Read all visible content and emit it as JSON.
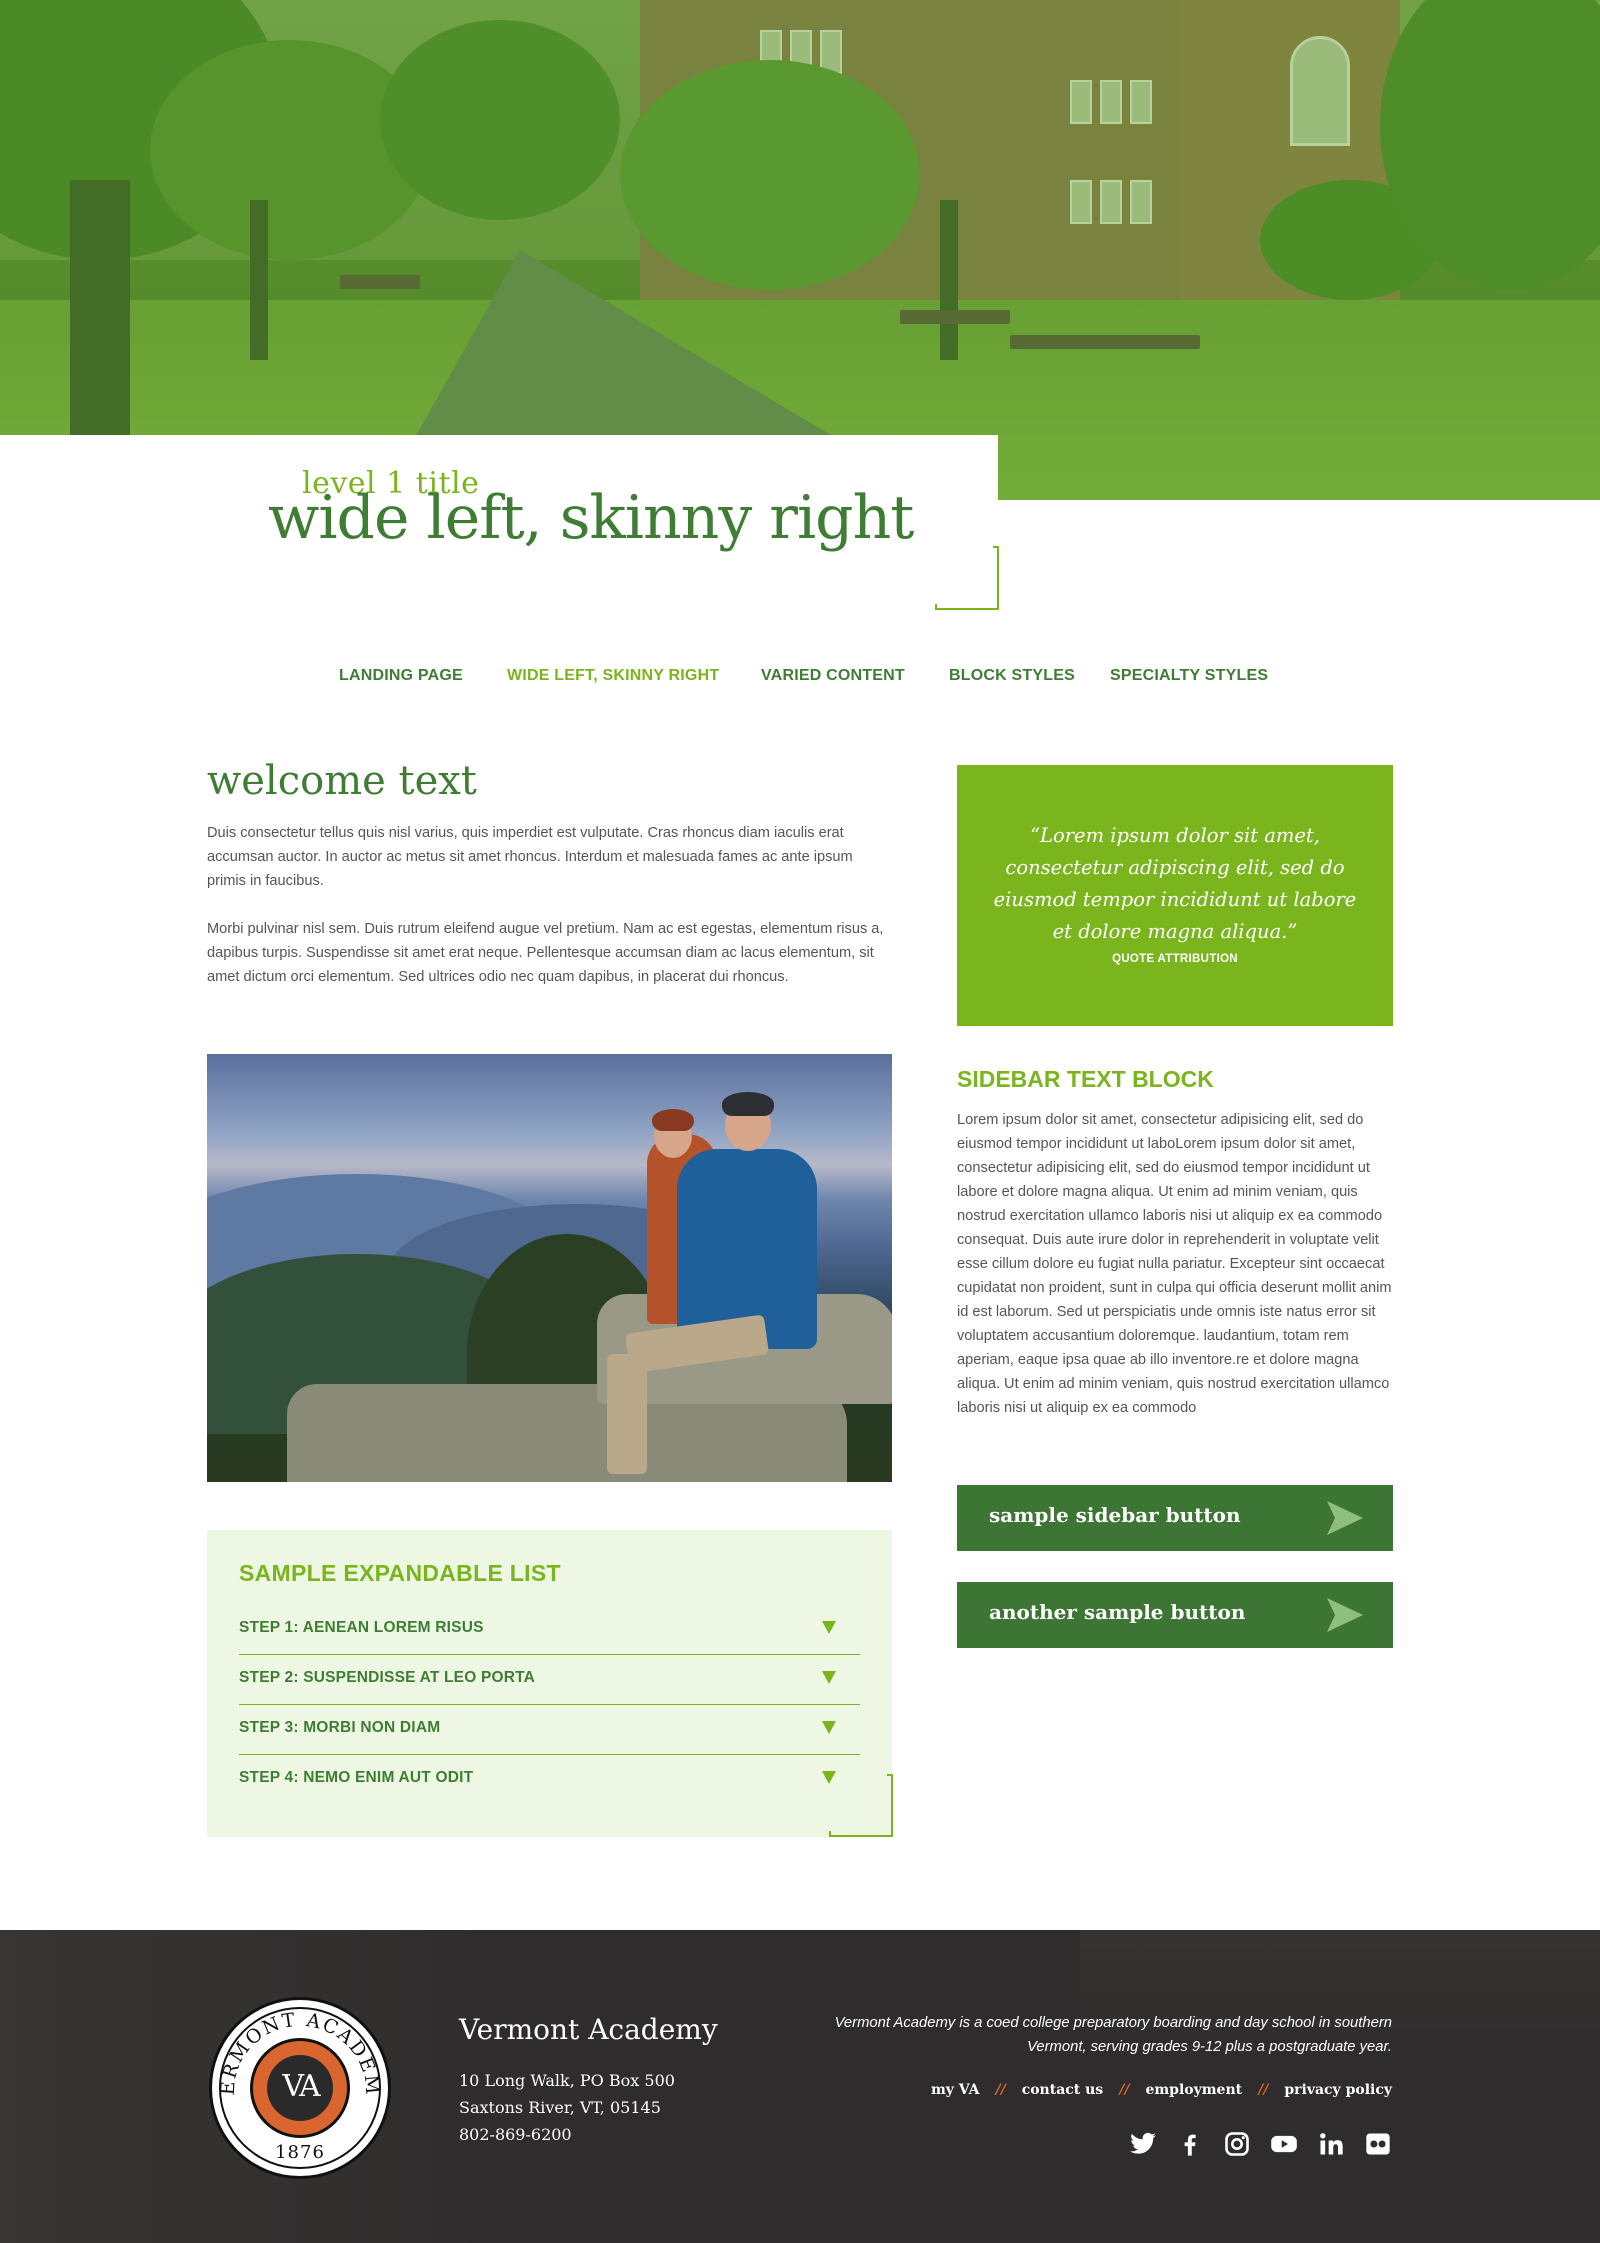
{
  "hero": {
    "kicker": "level 1 title",
    "title": "wide left, skinny right"
  },
  "nav": {
    "items": [
      {
        "label": "LANDING PAGE",
        "active": false
      },
      {
        "label": "WIDE LEFT, SKINNY RIGHT",
        "active": true
      },
      {
        "label": "VARIED CONTENT",
        "active": false
      },
      {
        "label": "BLOCK STYLES",
        "active": false
      },
      {
        "label": "SPECIALTY STYLES",
        "active": false
      }
    ]
  },
  "main": {
    "heading": "welcome text",
    "paragraphs": [
      "Duis consectetur tellus quis nisl varius, quis imperdiet est vulputate. Cras rhoncus diam iaculis erat accumsan auctor. In auctor ac metus sit amet rhoncus. Interdum et malesuada fames ac ante ipsum primis in faucibus.",
      "Morbi pulvinar nisl sem. Duis rutrum eleifend augue vel pretium. Nam ac est egestas, elementum risus a, dapibus turpis. Suspendisse sit amet erat neque. Pellentesque accumsan diam ac lacus elementum, sit amet dictum orci elementum. Sed ultrices odio nec quam dapibus, in placerat dui rhoncus."
    ],
    "expandable": {
      "title": "SAMPLE EXPANDABLE LIST",
      "steps": [
        "STEP 1: AENEAN LOREM RISUS",
        "STEP 2: SUSPENDISSE AT LEO PORTA",
        "STEP 3: MORBI NON DIAM",
        "STEP 4: NEMO ENIM AUT ODIT"
      ]
    }
  },
  "sidebar": {
    "quote": "“Lorem ipsum dolor sit amet, consectetur adipiscing elit, sed do eiusmod tempor incididunt ut labore et dolore magna aliqua.”",
    "quote_attribution": "QUOTE ATTRIBUTION",
    "text_heading": "SIDEBAR TEXT BLOCK",
    "text_body": "Lorem ipsum dolor sit amet, consectetur adipisicing elit, sed do eiusmod tempor incididunt ut laboLorem ipsum dolor sit amet, consectetur adipisicing elit, sed do eiusmod tempor incididunt ut labore et dolore magna aliqua. Ut enim ad minim veniam, quis nostrud exercitation ullamco laboris nisi ut aliquip ex ea commodo consequat. Duis aute irure dolor in reprehenderit in voluptate velit esse cillum dolore eu fugiat nulla pariatur. Excepteur sint occaecat cupidatat non proident, sunt in culpa qui officia deserunt mollit anim id est laborum. Sed ut perspiciatis unde omnis iste natus error sit voluptatem accusantium doloremque. laudantium, totam rem aperiam, eaque ipsa quae ab illo inventore.re et dolore magna aliqua. Ut enim ad minim veniam, quis nostrud exercitation ullamco laboris nisi ut aliquip ex ea commodo",
    "buttons": [
      "sample sidebar button",
      "another sample button"
    ]
  },
  "footer": {
    "seal_top_text": "VERMONT ACADEMY",
    "seal_monogram": "VA",
    "seal_year": "1876",
    "school_name": "Vermont Academy",
    "address": [
      "10 Long Walk, PO Box 500",
      "Saxtons River, VT, 05145",
      "802-869-6200"
    ],
    "blurb": "Vermont Academy is a coed college preparatory boarding and day school in southern Vermont, serving grades 9-12 plus a postgraduate year.",
    "links": [
      "my VA",
      "contact us",
      "employment",
      "privacy policy"
    ],
    "link_separator": "//",
    "social": [
      "twitter-icon",
      "facebook-icon",
      "instagram-icon",
      "youtube-icon",
      "linkedin-icon",
      "flickr-icon"
    ]
  },
  "colors": {
    "brand_green": "#3f7d34",
    "accent_lime": "#7ab51d",
    "light_green_bg": "#eef6e4",
    "footer_bg": "#2f2c2d",
    "accent_orange": "#d9662e"
  }
}
